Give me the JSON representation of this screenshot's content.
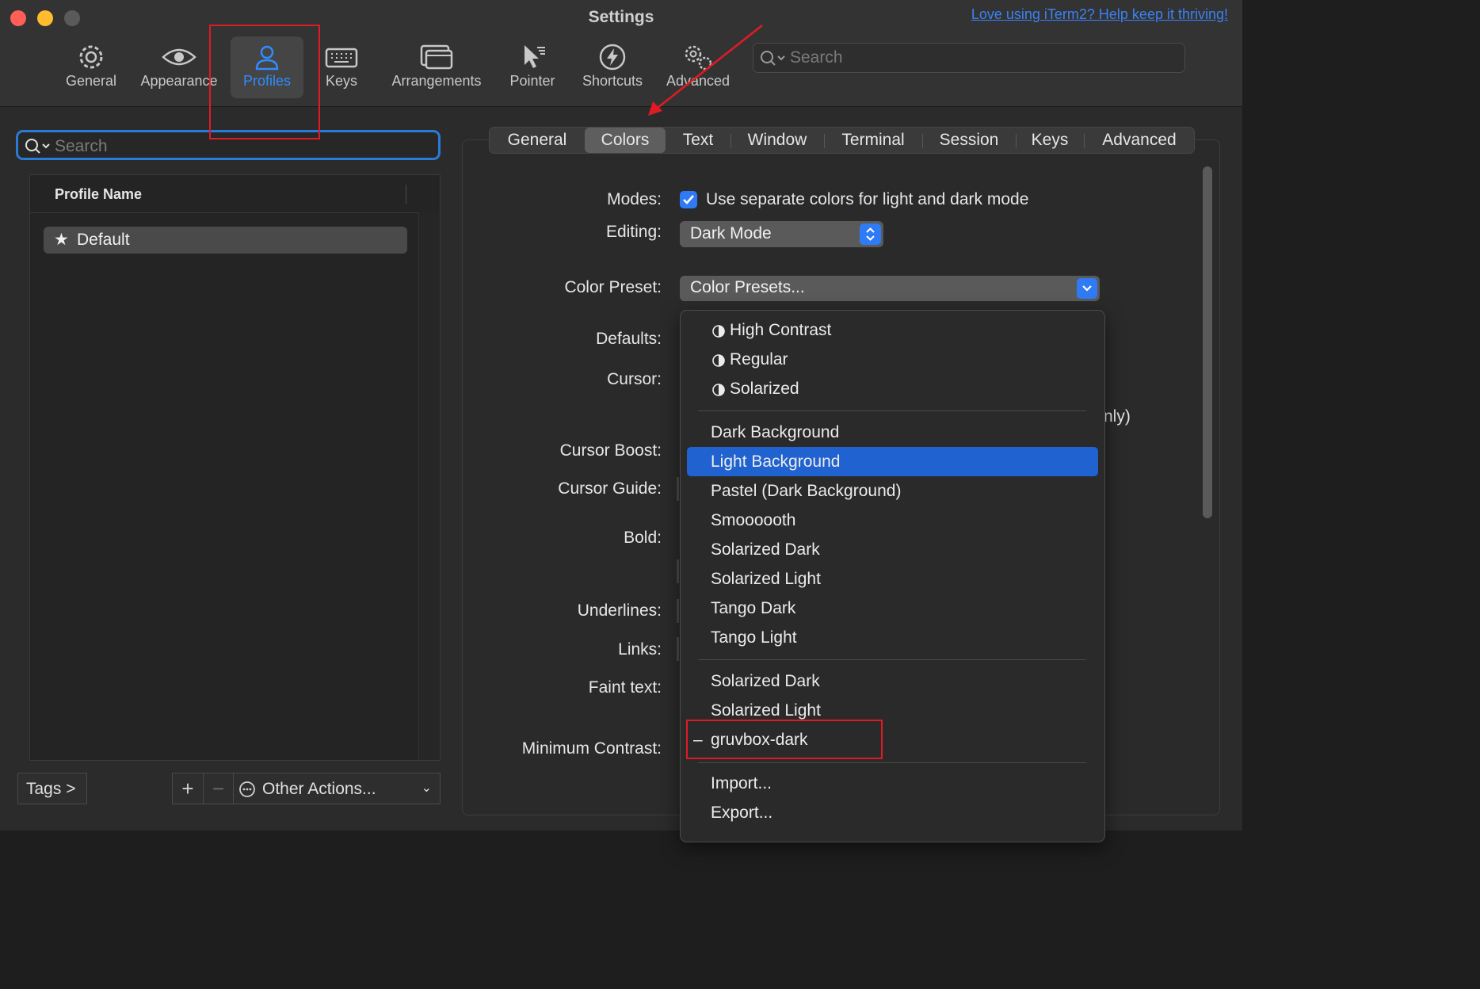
{
  "window": {
    "title": "Settings",
    "help_link": "Love using iTerm2? Help keep it thriving!"
  },
  "toolbar": {
    "items": [
      {
        "label": "General",
        "icon": "gear-icon"
      },
      {
        "label": "Appearance",
        "icon": "eye-icon"
      },
      {
        "label": "Profiles",
        "icon": "person-icon"
      },
      {
        "label": "Keys",
        "icon": "keyboard-icon"
      },
      {
        "label": "Arrangements",
        "icon": "windows-icon"
      },
      {
        "label": "Pointer",
        "icon": "pointer-icon"
      },
      {
        "label": "Shortcuts",
        "icon": "bolt-icon"
      },
      {
        "label": "Advanced",
        "icon": "gears-icon"
      }
    ],
    "active": "Profiles",
    "search_placeholder": "Search"
  },
  "profiles": {
    "search_placeholder": "Search",
    "column_header": "Profile Name",
    "rows": [
      {
        "name": "Default",
        "starred": true
      }
    ],
    "tags_button": "Tags >",
    "add_button": "+",
    "remove_button": "−",
    "other_actions": "Other Actions..."
  },
  "tabs": {
    "items": [
      "General",
      "Colors",
      "Text",
      "Window",
      "Terminal",
      "Session",
      "Keys",
      "Advanced"
    ],
    "active": "Colors"
  },
  "colors_pane": {
    "labels": {
      "modes": "Modes:",
      "editing": "Editing:",
      "color_preset": "Color Preset:",
      "defaults": "Defaults:",
      "cursor": "Cursor:",
      "cursor_boost": "Cursor Boost:",
      "cursor_guide": "Cursor Guide:",
      "bold": "Bold:",
      "underlines": "Underlines:",
      "links": "Links:",
      "faint_text": "Faint text:",
      "minimum_contrast": "Minimum Contrast:"
    },
    "modes_checkbox_label": "Use separate colors for light and dark mode",
    "modes_checked": true,
    "editing_value": "Dark Mode",
    "preset_value": "Color Presets...",
    "partial_text": "nly)"
  },
  "preset_menu": {
    "group1": [
      "High Contrast",
      "Regular",
      "Solarized"
    ],
    "group2": [
      "Dark Background",
      "Light Background",
      "Pastel (Dark Background)",
      "Smoooooth",
      "Solarized Dark",
      "Solarized Light",
      "Tango Dark",
      "Tango Light"
    ],
    "highlighted": "Light Background",
    "group3": [
      "Solarized Dark",
      "Solarized Light",
      "gruvbox-dark"
    ],
    "current_marker": "–",
    "group4": [
      "Import...",
      "Export..."
    ]
  },
  "colors": {
    "accent": "#2f7bf5",
    "highlight": "#1f62d0",
    "annotation": "#e01b24"
  }
}
